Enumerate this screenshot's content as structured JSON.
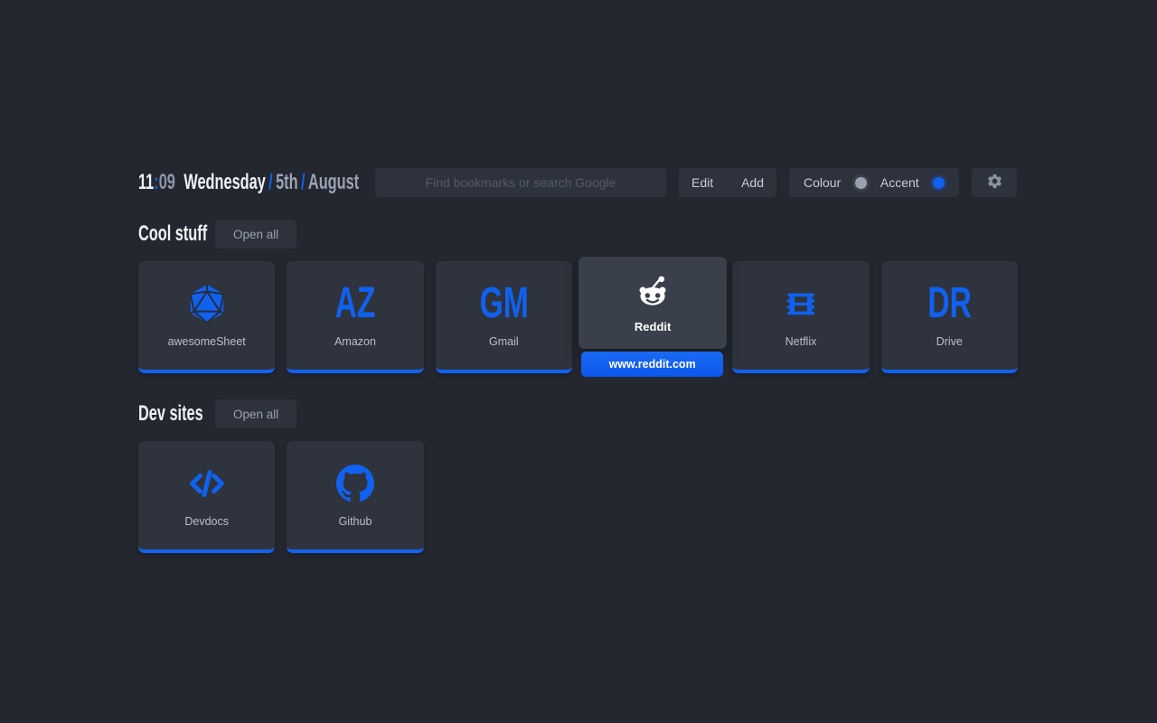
{
  "header": {
    "clock": {
      "hours": "11",
      "separator": ":",
      "minutes": "09"
    },
    "date": {
      "weekday": "Wednesday",
      "separator": "/",
      "day": "5th",
      "month": "August"
    },
    "search": {
      "placeholder": "Find bookmarks or search Google"
    },
    "edit_label": "Edit",
    "add_label": "Add",
    "colour_label": "Colour",
    "accent_label": "Accent",
    "settings_icon": "gear-icon"
  },
  "colors": {
    "accent": "#1161f0",
    "colour_dot": "#9aa2b2",
    "background": "#24272f",
    "tile": "#2e333d",
    "tile_hover": "#3a404b"
  },
  "sections": [
    {
      "title": "Cool stuff",
      "open_all_label": "Open all",
      "bookmarks": [
        {
          "label": "awesomeSheet",
          "icon": "icosahedron-icon"
        },
        {
          "label": "Amazon",
          "initials": "AZ"
        },
        {
          "label": "Gmail",
          "initials": "GM"
        },
        {
          "label": "Reddit",
          "icon": "reddit-icon",
          "hovered": true,
          "tooltip": "www.reddit.com"
        },
        {
          "label": "Netflix",
          "icon": "film-strip-icon"
        },
        {
          "label": "Drive",
          "initials": "DR"
        }
      ]
    },
    {
      "title": "Dev sites",
      "open_all_label": "Open all",
      "bookmarks": [
        {
          "label": "Devdocs",
          "icon": "code-icon"
        },
        {
          "label": "Github",
          "icon": "github-icon"
        }
      ]
    }
  ]
}
